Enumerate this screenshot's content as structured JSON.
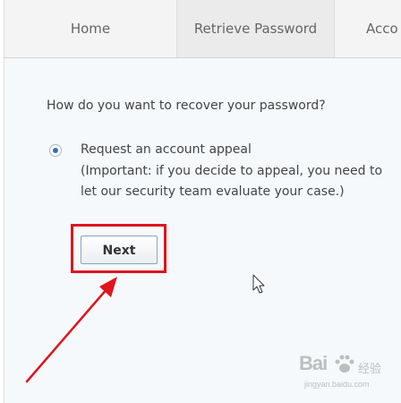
{
  "tabs": {
    "home": "Home",
    "retrieve": "Retrieve Password",
    "account": "Acco"
  },
  "question": "How do you want to recover your password?",
  "option": {
    "title": "Request an account appeal",
    "note_line1": "(Important: if you decide to appeal, you need to",
    "note_line2": "let our security team evaluate your case.)",
    "selected": true
  },
  "next_button": {
    "label": "Next"
  },
  "watermark": {
    "main": "Bai",
    "sub": "经验",
    "url": "jingyan.baidu.com"
  },
  "colors": {
    "highlight": "#e0141e",
    "radio_dot": "#3a6ea8",
    "background": "#f5f9fc"
  },
  "icons": [
    "radio-selected-icon",
    "mouse-cursor-icon",
    "red-arrow-icon",
    "paw-icon"
  ]
}
